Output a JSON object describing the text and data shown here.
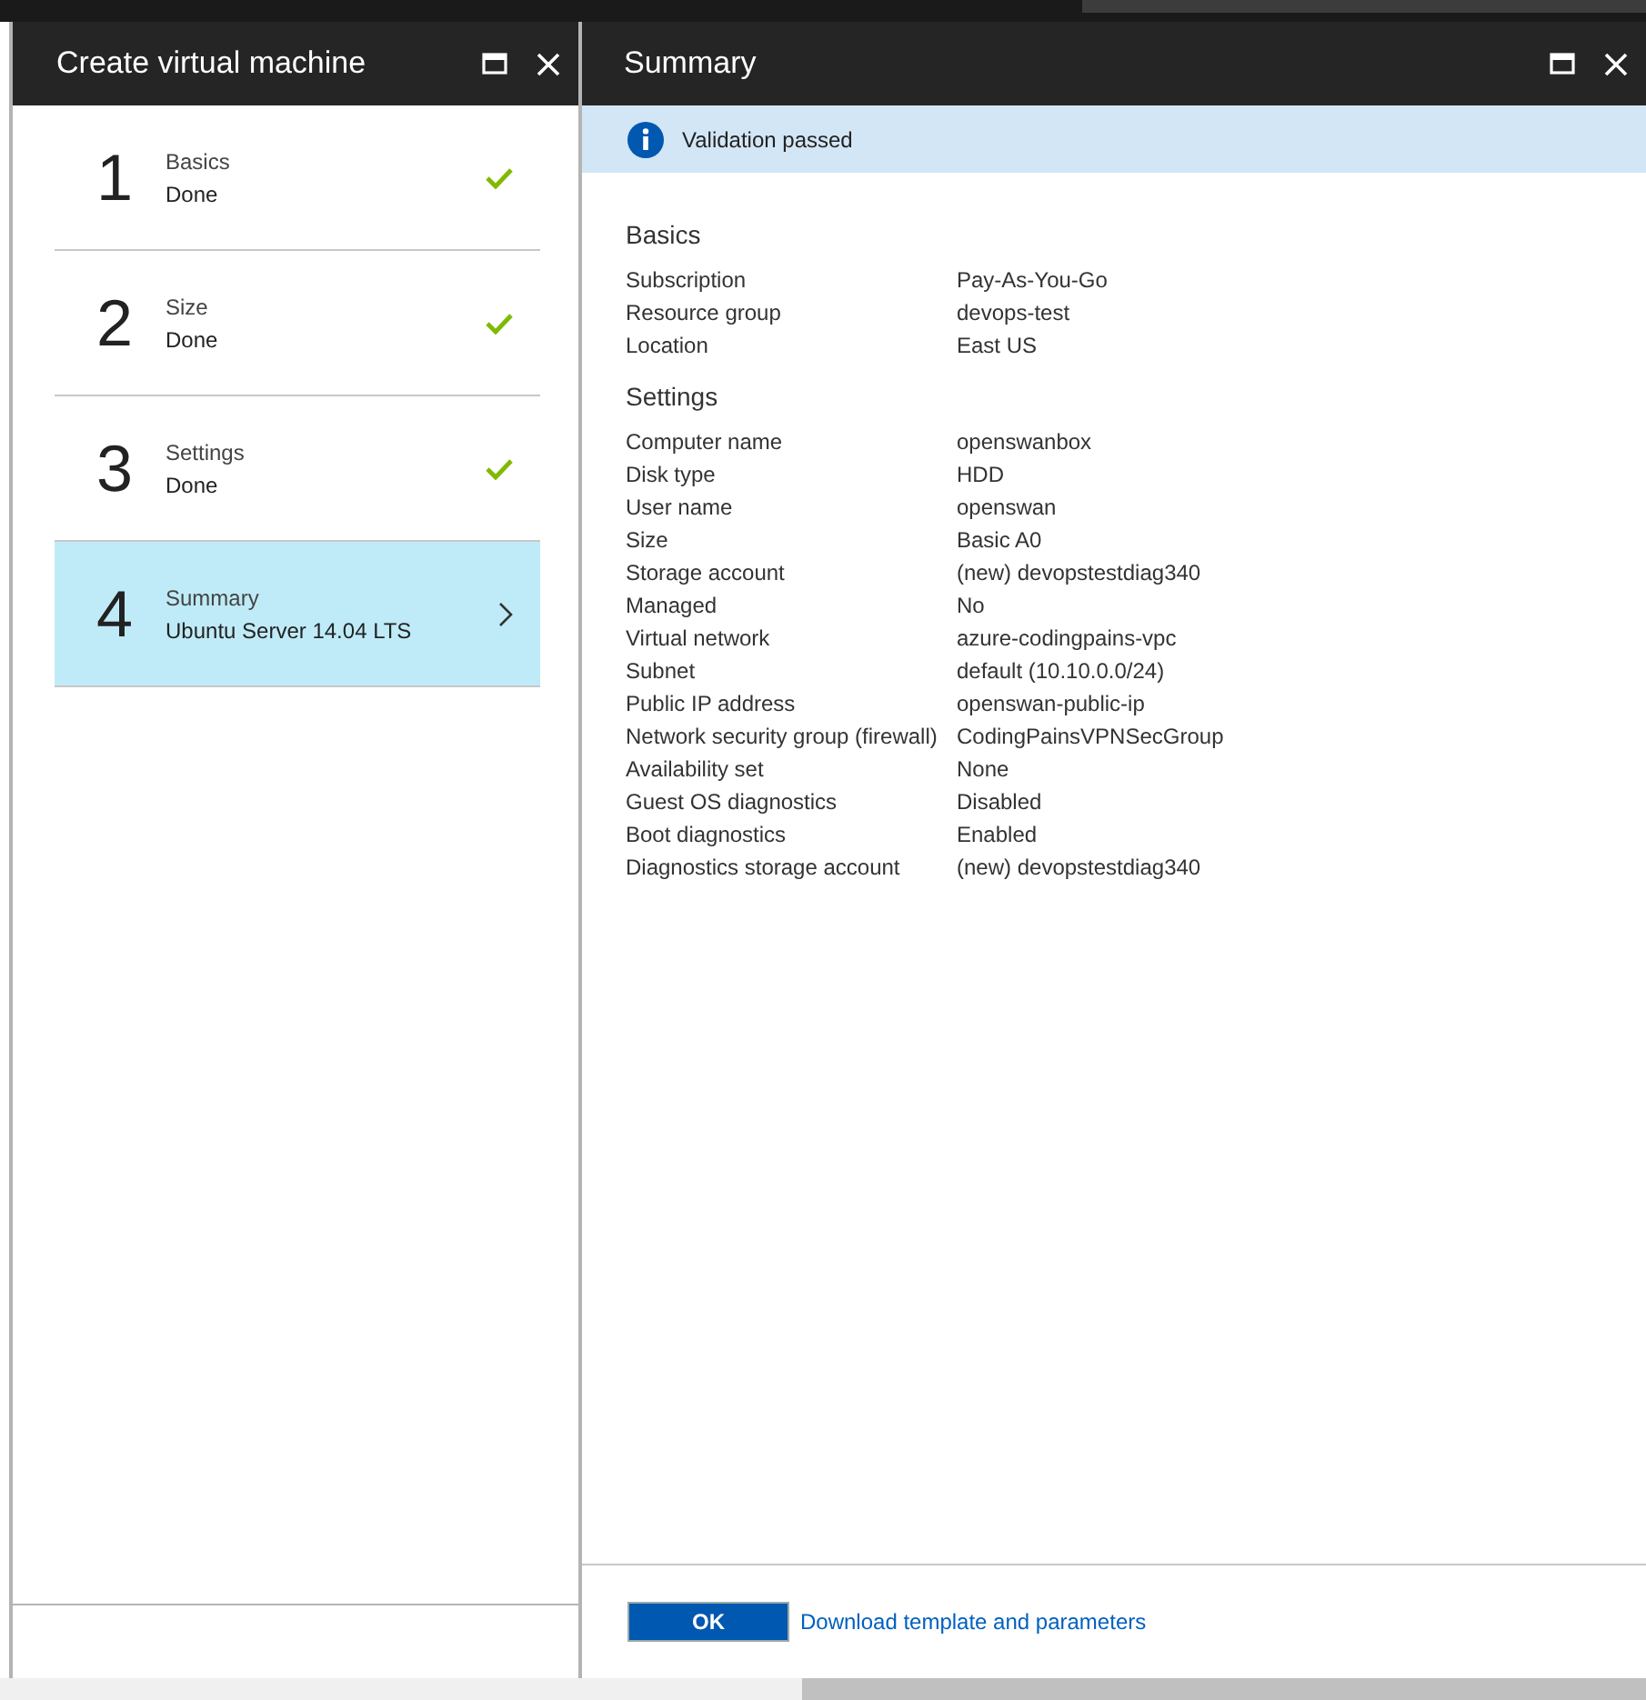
{
  "left_blade": {
    "title": "Create virtual machine",
    "steps": [
      {
        "number": "1",
        "name": "Basics",
        "status": "Done",
        "completed": true,
        "selected": false
      },
      {
        "number": "2",
        "name": "Size",
        "status": "Done",
        "completed": true,
        "selected": false
      },
      {
        "number": "3",
        "name": "Settings",
        "status": "Done",
        "completed": true,
        "selected": false
      },
      {
        "number": "4",
        "name": "Summary",
        "status": "Ubuntu Server 14.04 LTS",
        "completed": false,
        "selected": true
      }
    ]
  },
  "right_blade": {
    "title": "Summary",
    "banner": "Validation passed",
    "sections": [
      {
        "heading": "Basics",
        "rows": [
          {
            "label": "Subscription",
            "value": "Pay-As-You-Go"
          },
          {
            "label": "Resource group",
            "value": "devops-test"
          },
          {
            "label": "Location",
            "value": "East US"
          }
        ]
      },
      {
        "heading": "Settings",
        "rows": [
          {
            "label": "Computer name",
            "value": "openswanbox"
          },
          {
            "label": "Disk type",
            "value": "HDD"
          },
          {
            "label": "User name",
            "value": "openswan"
          },
          {
            "label": "Size",
            "value": "Basic A0"
          },
          {
            "label": "Storage account",
            "value": "(new) devopstestdiag340"
          },
          {
            "label": "Managed",
            "value": "No"
          },
          {
            "label": "Virtual network",
            "value": "azure-codingpains-vpc"
          },
          {
            "label": "Subnet",
            "value": "default (10.10.0.0/24)"
          },
          {
            "label": "Public IP address",
            "value": "openswan-public-ip"
          },
          {
            "label": "Network security group (firewall)",
            "value": "CodingPainsVPNSecGroup"
          },
          {
            "label": "Availability set",
            "value": "None"
          },
          {
            "label": "Guest OS diagnostics",
            "value": "Disabled"
          },
          {
            "label": "Boot diagnostics",
            "value": "Enabled"
          },
          {
            "label": "Diagnostics storage account",
            "value": "(new) devopstestdiag340"
          }
        ]
      }
    ],
    "ok_button": "OK",
    "link": "Download template and parameters"
  }
}
